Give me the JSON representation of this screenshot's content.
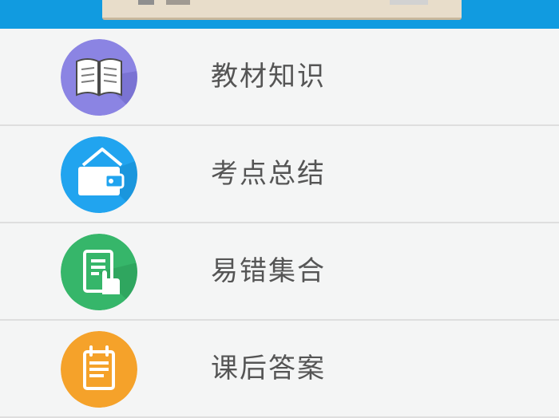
{
  "colors": {
    "header": "#119be0",
    "purple": "#8b84e3",
    "blue": "#21a4ef",
    "green": "#36b66a",
    "orange": "#f5a22a"
  },
  "menu": {
    "items": [
      {
        "label": "教材知识",
        "icon": "book-icon"
      },
      {
        "label": "考点总结",
        "icon": "wallet-icon"
      },
      {
        "label": "易错集合",
        "icon": "document-touch-icon"
      },
      {
        "label": "课后答案",
        "icon": "notepad-icon"
      }
    ]
  }
}
